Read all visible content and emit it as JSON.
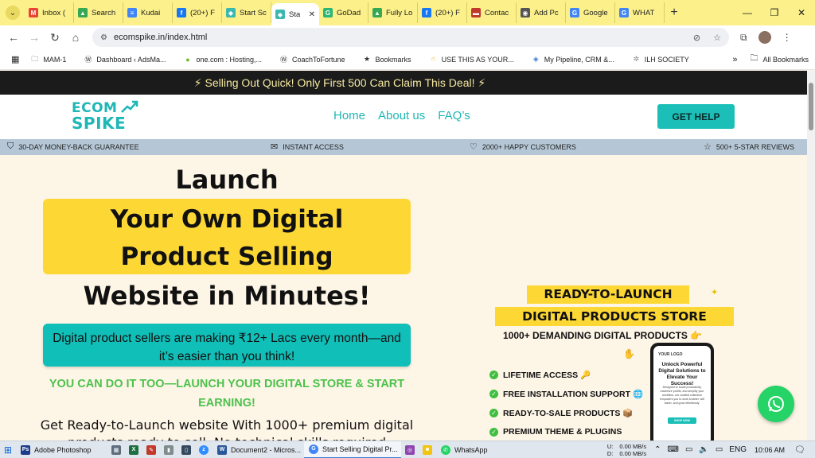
{
  "browser": {
    "tabs": [
      {
        "label": "Inbox (",
        "favicon_color": "#ea4335",
        "favicon_glyph": "M"
      },
      {
        "label": "Search",
        "favicon_color": "#34a853",
        "favicon_glyph": "▲"
      },
      {
        "label": "Kudai",
        "favicon_color": "#4285f4",
        "favicon_glyph": "≡"
      },
      {
        "label": "(20+) F",
        "favicon_color": "#1877f2",
        "favicon_glyph": "f"
      },
      {
        "label": "Start Sc",
        "favicon_color": "#3bb8b0",
        "favicon_glyph": "◆"
      },
      {
        "label": "Sta",
        "favicon_color": "#3bb8b0",
        "favicon_glyph": "◆",
        "active": true
      },
      {
        "label": "GoDad",
        "favicon_color": "#2bb673",
        "favicon_glyph": "G"
      },
      {
        "label": "Fully Lo",
        "favicon_color": "#34a853",
        "favicon_glyph": "▲"
      },
      {
        "label": "(20+) F",
        "favicon_color": "#1877f2",
        "favicon_glyph": "f"
      },
      {
        "label": "Contac",
        "favicon_color": "#c0392b",
        "favicon_glyph": "▬"
      },
      {
        "label": "Add Pc",
        "favicon_color": "#555555",
        "favicon_glyph": "◉"
      },
      {
        "label": "Google",
        "favicon_color": "#4285f4",
        "favicon_glyph": "G"
      },
      {
        "label": "WHAT",
        "favicon_color": "#4285f4",
        "favicon_glyph": "G"
      }
    ],
    "url": "ecomspike.in/index.html",
    "bookmarks": [
      {
        "label": "MAM-1",
        "icon": "folder-icon"
      },
      {
        "label": "Dashboard ‹ AdsMa...",
        "icon": "wordpress-icon"
      },
      {
        "label": "one.com : Hosting,...",
        "icon": "onecom-icon"
      },
      {
        "label": "CoachToFortune",
        "icon": "wordpress-icon"
      },
      {
        "label": "Bookmarks",
        "icon": "star-icon"
      },
      {
        "label": "USE THIS AS YOUR...",
        "icon": "hand-icon"
      },
      {
        "label": "My Pipeline, CRM &...",
        "icon": "crm-icon"
      },
      {
        "label": "ILH SOCIETY",
        "icon": "society-icon"
      }
    ],
    "all_bookmarks": "All Bookmarks"
  },
  "site": {
    "announcement": "⚡ Selling Out Quick! Only First 500 Can Claim This Deal! ⚡",
    "logo_top": "ECOM",
    "logo_bottom": "SPIKE",
    "nav": [
      "Home",
      "About us",
      "FAQ’s"
    ],
    "help_button": "GET HELP",
    "trust": [
      {
        "label": "30-DAY MONEY-BACK GUARANTEE",
        "icon": "shield-check-icon"
      },
      {
        "label": "INSTANT ACCESS",
        "icon": "envelope-icon"
      },
      {
        "label": "2000+ HAPPY CUSTOMERS",
        "icon": "heart-icon"
      },
      {
        "label": "500+ 5-STAR REVIEWS",
        "icon": "star-icon"
      }
    ],
    "hero": {
      "line1": "Launch",
      "highlight_line1": "Your Own Digital",
      "highlight_line2": "Product Selling",
      "line3": "Website in Minutes!",
      "teal_text": "Digital product sellers are making ₹12+ Lacs every month—and it’s easier than you think!",
      "green_text": "YOU CAN DO IT TOO—LAUNCH YOUR DIGITAL STORE & START EARNING!",
      "body_text": "Get Ready-to-Launch website With 1000+ premium digital products ready to sell. No technical skills required"
    },
    "promo": {
      "title1": "READY-TO-LAUNCH",
      "title2": "DIGITAL PRODUCTS STORE",
      "subtitle": "1000+ DEMANDING DIGITAL PRODUCTS 👉",
      "features": [
        "LIFETIME ACCESS 🔑",
        "FREE INSTALLATION SUPPORT 🌐",
        "READY-TO-SALE PRODUCTS 📦",
        "PREMIUM THEME & PLUGINS"
      ],
      "phone_logo": "YOUR LOGO",
      "phone_heading": "Unlock Powerful Digital Solutions to Elevate Your Success!",
      "phone_body": "Designed to boost productivity, maximize profits, and simplify your workflow, our curated collection empowers you to work smarter, sell faster, and grow effortlessly.",
      "phone_button": "SHOP NOW"
    }
  },
  "taskbar": {
    "apps": [
      {
        "label": "Adobe Photoshop",
        "color": "#1b3b8a",
        "glyph": "Ps"
      },
      {
        "label": "Document2 - Micros...",
        "color": "#2b579a",
        "glyph": "W"
      },
      {
        "label": "Start Selling Digital Pr...",
        "color": "#4285f4",
        "glyph": "G",
        "active": true
      },
      {
        "label": "WhatsApp",
        "color": "#25d366",
        "glyph": "✆"
      }
    ],
    "net_up_label": "U:",
    "net_up": "0.00 MB/s",
    "net_down_label": "D:",
    "net_down": "0.00 MB/s",
    "lang": "ENG",
    "time": "10:06 AM"
  }
}
